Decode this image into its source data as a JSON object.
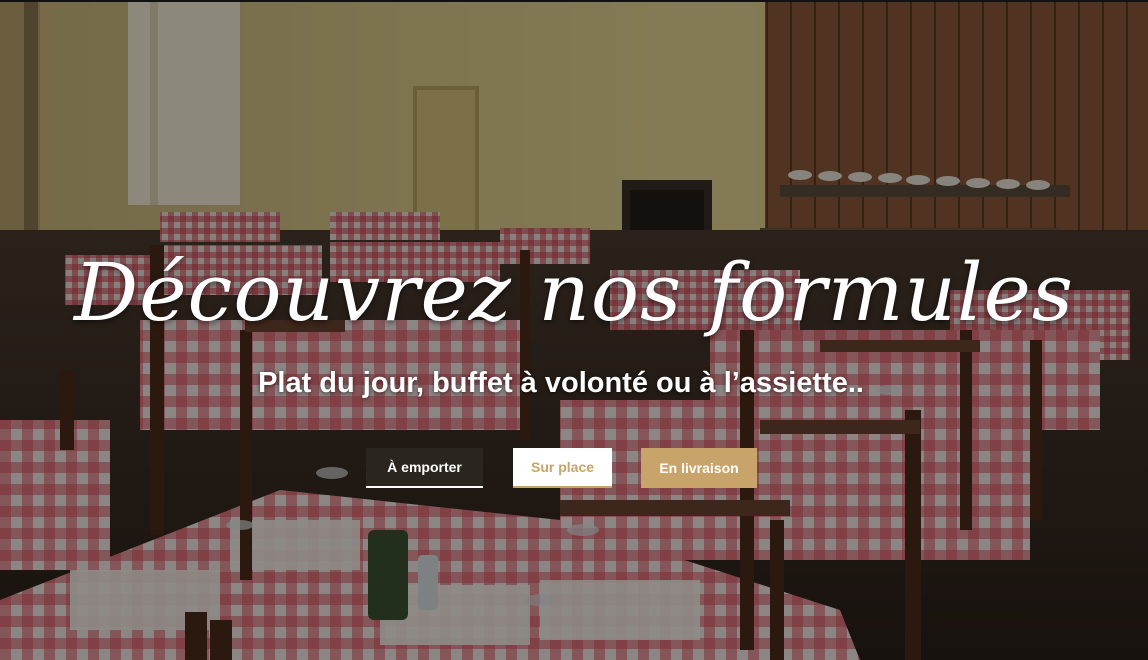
{
  "hero": {
    "title": "Découvrez nos formules",
    "subtitle": "Plat du jour, buffet à volonté ou à l’assiette.."
  },
  "buttons": {
    "emporter_label": "À emporter",
    "surplace_label": "Sur place",
    "livraison_label": "En livraison"
  },
  "colors": {
    "accent": "#c9a46a",
    "dark_button": "#2b2520",
    "text": "#ffffff"
  }
}
